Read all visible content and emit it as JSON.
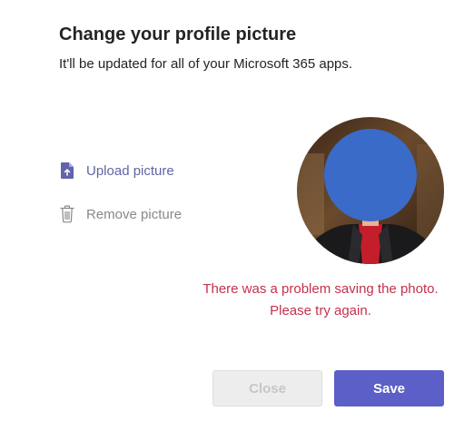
{
  "dialog": {
    "title": "Change your profile picture",
    "subtitle": "It'll be updated for all of your Microsoft 365 apps."
  },
  "actions": {
    "upload_label": "Upload picture",
    "upload_icon": "upload-file-icon",
    "remove_label": "Remove picture",
    "remove_icon": "trash-icon"
  },
  "error_message": "There was a problem saving the photo. Please try again.",
  "buttons": {
    "close_label": "Close",
    "save_label": "Save"
  },
  "colors": {
    "accent": "#5b5fc7",
    "link": "#6264a7",
    "error": "#c4314b",
    "disabled_text": "#c8c6c4",
    "redaction": "#3a6bc9"
  }
}
